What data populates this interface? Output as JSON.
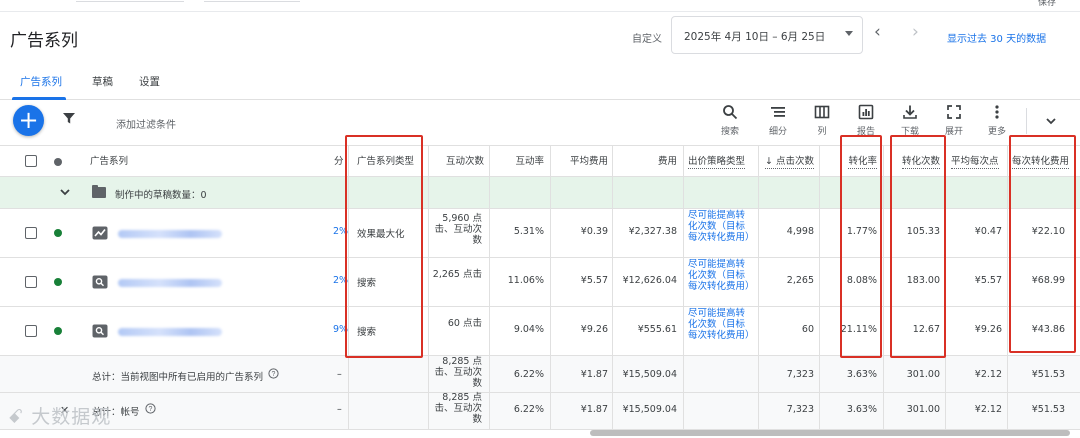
{
  "top": {
    "save": "保存"
  },
  "page_title": "广告系列",
  "date": {
    "label": "自定义",
    "value": "2025年 4月 10日 – 6月 25日"
  },
  "show_link": "显示过去 30 天的数据",
  "tabs": [
    "广告系列",
    "草稿",
    "设置"
  ],
  "toolbar": {
    "add_filter": "添加过滤条件",
    "items": [
      {
        "label": "搜索",
        "icon": "search-icon"
      },
      {
        "label": "细分",
        "icon": "segment-icon"
      },
      {
        "label": "列",
        "icon": "columns-icon"
      },
      {
        "label": "报告",
        "icon": "report-icon"
      },
      {
        "label": "下载",
        "icon": "download-icon"
      },
      {
        "label": "展开",
        "icon": "expand-icon"
      },
      {
        "label": "更多",
        "icon": "more-vert-icon"
      }
    ]
  },
  "columns": {
    "campaign": "广告系列",
    "score": "分",
    "type": "广告系列类型",
    "interactions": "互动次数",
    "interaction_rate": "互动率",
    "avg_cost": "平均费用",
    "cost": "费用",
    "bid_strategy": "出价策略类型",
    "clicks": "↓ 点击次数",
    "conv_rate": "转化率",
    "conversions": "转化次数",
    "avg_cpc": "平均每次点",
    "cost_per_conv": "每次转化费用"
  },
  "draft_row": "制作中的草稿数量：0",
  "rows": [
    {
      "score": "2%",
      "type": "效果最大化",
      "interactions": "5,960 点击、互动次数",
      "interaction_rate": "5.31%",
      "avg_cost": "¥0.39",
      "cost": "¥2,327.38",
      "bid_strategy": "尽可能提高转化次数（目标每次转化费用）",
      "clicks": "4,998",
      "conv_rate": "1.77%",
      "conversions": "105.33",
      "avg_cpc": "¥0.47",
      "cost_per_conv": "¥22.10"
    },
    {
      "score": "2%",
      "type": "搜索",
      "interactions": "2,265 点击",
      "interaction_rate": "11.06%",
      "avg_cost": "¥5.57",
      "cost": "¥12,626.04",
      "bid_strategy": "尽可能提高转化次数（目标每次转化费用）",
      "clicks": "2,265",
      "conv_rate": "8.08%",
      "conversions": "183.00",
      "avg_cpc": "¥5.57",
      "cost_per_conv": "¥68.99"
    },
    {
      "score": "9%",
      "type": "搜索",
      "interactions": "60 点击",
      "interaction_rate": "9.04%",
      "avg_cost": "¥9.26",
      "cost": "¥555.61",
      "bid_strategy": "尽可能提高转化次数（目标每次转化费用）",
      "clicks": "60",
      "conv_rate": "21.11%",
      "conversions": "12.67",
      "avg_cpc": "¥9.26",
      "cost_per_conv": "¥43.86"
    }
  ],
  "totals": [
    {
      "label": "总计：当前视图中所有已启用的广告系列",
      "score": "–",
      "interactions": "8,285 点击、互动次数",
      "interaction_rate": "6.22%",
      "avg_cost": "¥1.87",
      "cost": "¥15,509.04",
      "clicks": "7,323",
      "conv_rate": "3.63%",
      "conversions": "301.00",
      "avg_cpc": "¥2.12",
      "cost_per_conv": "¥51.53"
    },
    {
      "label": "总计：帐号",
      "score": "–",
      "interactions": "8,285 点击、互动次数",
      "interaction_rate": "6.22%",
      "avg_cost": "¥1.87",
      "cost": "¥15,509.04",
      "clicks": "7,323",
      "conv_rate": "3.63%",
      "conversions": "301.00",
      "avg_cpc": "¥2.12",
      "cost_per_conv": "¥51.53"
    }
  ],
  "watermark": "大数据观",
  "colors": {
    "accent": "#1a73e8",
    "highlight": "#d93025",
    "status_enabled": "#188038",
    "draft_bg": "#e6f4ea"
  }
}
